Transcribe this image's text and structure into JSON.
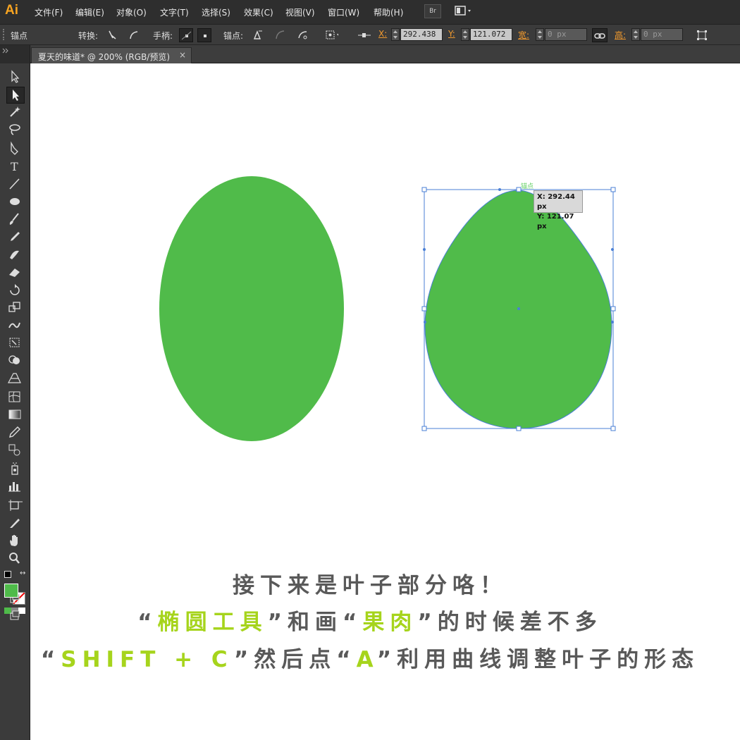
{
  "app": {
    "logo": "Ai",
    "accent": "#f7a421"
  },
  "menubar": {
    "items": [
      "文件(F)",
      "编辑(E)",
      "对象(O)",
      "文字(T)",
      "选择(S)",
      "效果(C)",
      "视图(V)",
      "窗口(W)",
      "帮助(H)"
    ],
    "br_button": "Br"
  },
  "control_bar": {
    "selection_label": "锚点",
    "convert_label": "转换:",
    "handles_label": "手柄:",
    "anchors_label": "锚点:",
    "x_label": "X:",
    "x_value": "292.438",
    "y_label": "Y:",
    "y_value": "121.072",
    "width_label": "宽:",
    "width_value": "0 px",
    "height_label": "高:",
    "height_value": "0 px"
  },
  "document_tab": {
    "title": "夏天的味道* @ 200% (RGB/预览)",
    "close": "×"
  },
  "toolbar": {
    "tools": [
      "selection-tool",
      "direct-selection-tool",
      "magic-wand-tool",
      "lasso-tool",
      "pen-tool",
      "type-tool",
      "line-tool",
      "ellipse-tool",
      "paintbrush-tool",
      "pencil-tool",
      "blob-brush-tool",
      "eraser-tool",
      "rotate-tool",
      "scale-tool",
      "warp-tool",
      "free-transform-tool",
      "shape-builder-tool",
      "perspective-grid-tool",
      "mesh-tool",
      "gradient-tool",
      "eyedropper-tool",
      "blend-tool",
      "symbol-sprayer-tool",
      "column-graph-tool",
      "artboard-tool",
      "slice-tool",
      "hand-tool",
      "zoom-tool"
    ],
    "fill_color": "#4fbb4a"
  },
  "artwork": {
    "fill_color": "#50bb4a",
    "path_color": "#4a7fd6",
    "anchor_label": "锚点",
    "tooltip_x": "X: 292.44 px",
    "tooltip_y": "Y: 121.07 px"
  },
  "caption": {
    "line1": "接下来是叶子部分咯！",
    "line2_q1": "“",
    "line2_hl1": "椭圆工具",
    "line2_q2": "”",
    "line2_mid": "和画",
    "line2_q3": "“",
    "line2_hl2": "果肉",
    "line2_q4": "”",
    "line2_end": "的时候差不多",
    "line3_q1": "“",
    "line3_hl1": "SHIFT + C",
    "line3_q2": "”",
    "line3_mid": "然后点",
    "line3_q3": "“",
    "line3_hl2": "A",
    "line3_q4": "”",
    "line3_end": "利用曲线调整叶子的形态",
    "highlight_color": "#a6d41c",
    "text_color": "#595959"
  }
}
